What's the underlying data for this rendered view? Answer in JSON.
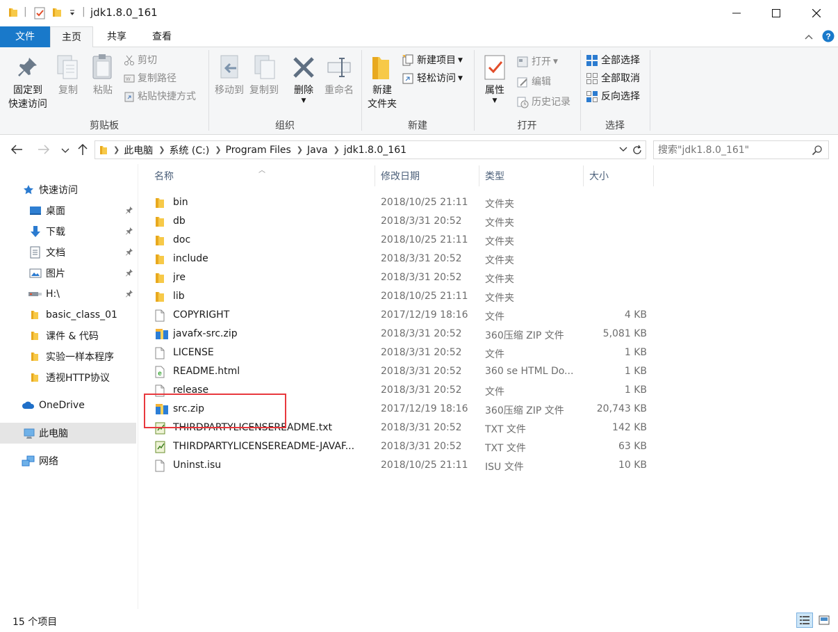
{
  "window": {
    "title": "jdk1.8.0_161"
  },
  "ribbon_tabs": [
    {
      "label": "文件"
    },
    {
      "label": "主页"
    },
    {
      "label": "共享"
    },
    {
      "label": "查看"
    }
  ],
  "ribbon": {
    "clipboard": {
      "group_label": "剪贴板",
      "pin_line1": "固定到",
      "pin_line2": "快速访问",
      "copy": "复制",
      "paste": "粘贴",
      "cut": "剪切",
      "copy_path": "复制路径",
      "paste_shortcut": "粘贴快捷方式"
    },
    "organize": {
      "group_label": "组织",
      "move_to": "移动到",
      "copy_to": "复制到",
      "delete": "删除",
      "rename": "重命名"
    },
    "new": {
      "group_label": "新建",
      "new_folder_line1": "新建",
      "new_folder_line2": "文件夹",
      "new_item": "新建项目",
      "easy_access": "轻松访问"
    },
    "open": {
      "group_label": "打开",
      "properties": "属性",
      "open": "打开",
      "edit": "编辑",
      "history": "历史记录"
    },
    "select": {
      "group_label": "选择",
      "select_all": "全部选择",
      "select_none": "全部取消",
      "invert": "反向选择"
    }
  },
  "address": {
    "breadcrumb": [
      "此电脑",
      "系统 (C:)",
      "Program Files",
      "Java",
      "jdk1.8.0_161"
    ],
    "search_placeholder": "搜索\"jdk1.8.0_161\""
  },
  "nav": {
    "quick_access": "快速访问",
    "pinned": [
      {
        "label": "桌面"
      },
      {
        "label": "下载"
      },
      {
        "label": "文档"
      },
      {
        "label": "图片"
      },
      {
        "label": "H:\\"
      }
    ],
    "folders": [
      {
        "label": "basic_class_01"
      },
      {
        "label": "课件 & 代码"
      },
      {
        "label": "实验一样本程序"
      },
      {
        "label": "透视HTTP协议"
      }
    ],
    "onedrive": "OneDrive",
    "this_pc": "此电脑",
    "network": "网络"
  },
  "columns": {
    "name": "名称",
    "date": "修改日期",
    "type": "类型",
    "size": "大小"
  },
  "files": [
    {
      "name": "bin",
      "date": "2018/10/25 21:11",
      "type": "文件夹",
      "size": "",
      "icon": "folder-icon"
    },
    {
      "name": "db",
      "date": "2018/3/31 20:52",
      "type": "文件夹",
      "size": "",
      "icon": "folder-icon"
    },
    {
      "name": "doc",
      "date": "2018/10/25 21:11",
      "type": "文件夹",
      "size": "",
      "icon": "folder-icon"
    },
    {
      "name": "include",
      "date": "2018/3/31 20:52",
      "type": "文件夹",
      "size": "",
      "icon": "folder-icon"
    },
    {
      "name": "jre",
      "date": "2018/3/31 20:52",
      "type": "文件夹",
      "size": "",
      "icon": "folder-icon"
    },
    {
      "name": "lib",
      "date": "2018/10/25 21:11",
      "type": "文件夹",
      "size": "",
      "icon": "folder-icon"
    },
    {
      "name": "COPYRIGHT",
      "date": "2017/12/19 18:16",
      "type": "文件",
      "size": "4 KB",
      "icon": "file-icon"
    },
    {
      "name": "javafx-src.zip",
      "date": "2018/3/31 20:52",
      "type": "360压缩 ZIP 文件",
      "size": "5,081 KB",
      "icon": "zip-icon"
    },
    {
      "name": "LICENSE",
      "date": "2018/3/31 20:52",
      "type": "文件",
      "size": "1 KB",
      "icon": "file-icon"
    },
    {
      "name": "README.html",
      "date": "2018/3/31 20:52",
      "type": "360 se HTML Do...",
      "size": "1 KB",
      "icon": "html-icon"
    },
    {
      "name": "release",
      "date": "2018/3/31 20:52",
      "type": "文件",
      "size": "1 KB",
      "icon": "file-icon"
    },
    {
      "name": "src.zip",
      "date": "2017/12/19 18:16",
      "type": "360压缩 ZIP 文件",
      "size": "20,743 KB",
      "icon": "zip-icon"
    },
    {
      "name": "THIRDPARTYLICENSEREADME.txt",
      "date": "2018/3/31 20:52",
      "type": "TXT 文件",
      "size": "142 KB",
      "icon": "txt-icon"
    },
    {
      "name": "THIRDPARTYLICENSEREADME-JAVAF...",
      "date": "2018/3/31 20:52",
      "type": "TXT 文件",
      "size": "63 KB",
      "icon": "txt-icon"
    },
    {
      "name": "Uninst.isu",
      "date": "2018/10/25 21:11",
      "type": "ISU 文件",
      "size": "10 KB",
      "icon": "file-icon"
    }
  ],
  "status": {
    "item_count": "15 个项目"
  },
  "colors": {
    "accent": "#1979ca",
    "highlight": "#e8383d",
    "folder": "#f7c948"
  }
}
